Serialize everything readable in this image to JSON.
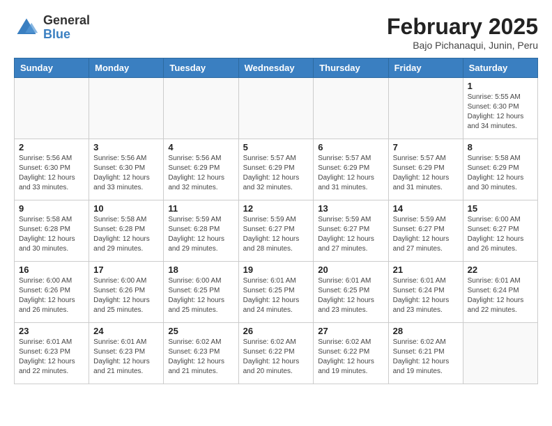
{
  "header": {
    "logo_general": "General",
    "logo_blue": "Blue",
    "title": "February 2025",
    "subtitle": "Bajo Pichanaqui, Junin, Peru"
  },
  "weekdays": [
    "Sunday",
    "Monday",
    "Tuesday",
    "Wednesday",
    "Thursday",
    "Friday",
    "Saturday"
  ],
  "weeks": [
    [
      {
        "day": "",
        "info": ""
      },
      {
        "day": "",
        "info": ""
      },
      {
        "day": "",
        "info": ""
      },
      {
        "day": "",
        "info": ""
      },
      {
        "day": "",
        "info": ""
      },
      {
        "day": "",
        "info": ""
      },
      {
        "day": "1",
        "info": "Sunrise: 5:55 AM\nSunset: 6:30 PM\nDaylight: 12 hours\nand 34 minutes."
      }
    ],
    [
      {
        "day": "2",
        "info": "Sunrise: 5:56 AM\nSunset: 6:30 PM\nDaylight: 12 hours\nand 33 minutes."
      },
      {
        "day": "3",
        "info": "Sunrise: 5:56 AM\nSunset: 6:30 PM\nDaylight: 12 hours\nand 33 minutes."
      },
      {
        "day": "4",
        "info": "Sunrise: 5:56 AM\nSunset: 6:29 PM\nDaylight: 12 hours\nand 32 minutes."
      },
      {
        "day": "5",
        "info": "Sunrise: 5:57 AM\nSunset: 6:29 PM\nDaylight: 12 hours\nand 32 minutes."
      },
      {
        "day": "6",
        "info": "Sunrise: 5:57 AM\nSunset: 6:29 PM\nDaylight: 12 hours\nand 31 minutes."
      },
      {
        "day": "7",
        "info": "Sunrise: 5:57 AM\nSunset: 6:29 PM\nDaylight: 12 hours\nand 31 minutes."
      },
      {
        "day": "8",
        "info": "Sunrise: 5:58 AM\nSunset: 6:29 PM\nDaylight: 12 hours\nand 30 minutes."
      }
    ],
    [
      {
        "day": "9",
        "info": "Sunrise: 5:58 AM\nSunset: 6:28 PM\nDaylight: 12 hours\nand 30 minutes."
      },
      {
        "day": "10",
        "info": "Sunrise: 5:58 AM\nSunset: 6:28 PM\nDaylight: 12 hours\nand 29 minutes."
      },
      {
        "day": "11",
        "info": "Sunrise: 5:59 AM\nSunset: 6:28 PM\nDaylight: 12 hours\nand 29 minutes."
      },
      {
        "day": "12",
        "info": "Sunrise: 5:59 AM\nSunset: 6:27 PM\nDaylight: 12 hours\nand 28 minutes."
      },
      {
        "day": "13",
        "info": "Sunrise: 5:59 AM\nSunset: 6:27 PM\nDaylight: 12 hours\nand 27 minutes."
      },
      {
        "day": "14",
        "info": "Sunrise: 5:59 AM\nSunset: 6:27 PM\nDaylight: 12 hours\nand 27 minutes."
      },
      {
        "day": "15",
        "info": "Sunrise: 6:00 AM\nSunset: 6:27 PM\nDaylight: 12 hours\nand 26 minutes."
      }
    ],
    [
      {
        "day": "16",
        "info": "Sunrise: 6:00 AM\nSunset: 6:26 PM\nDaylight: 12 hours\nand 26 minutes."
      },
      {
        "day": "17",
        "info": "Sunrise: 6:00 AM\nSunset: 6:26 PM\nDaylight: 12 hours\nand 25 minutes."
      },
      {
        "day": "18",
        "info": "Sunrise: 6:00 AM\nSunset: 6:25 PM\nDaylight: 12 hours\nand 25 minutes."
      },
      {
        "day": "19",
        "info": "Sunrise: 6:01 AM\nSunset: 6:25 PM\nDaylight: 12 hours\nand 24 minutes."
      },
      {
        "day": "20",
        "info": "Sunrise: 6:01 AM\nSunset: 6:25 PM\nDaylight: 12 hours\nand 23 minutes."
      },
      {
        "day": "21",
        "info": "Sunrise: 6:01 AM\nSunset: 6:24 PM\nDaylight: 12 hours\nand 23 minutes."
      },
      {
        "day": "22",
        "info": "Sunrise: 6:01 AM\nSunset: 6:24 PM\nDaylight: 12 hours\nand 22 minutes."
      }
    ],
    [
      {
        "day": "23",
        "info": "Sunrise: 6:01 AM\nSunset: 6:23 PM\nDaylight: 12 hours\nand 22 minutes."
      },
      {
        "day": "24",
        "info": "Sunrise: 6:01 AM\nSunset: 6:23 PM\nDaylight: 12 hours\nand 21 minutes."
      },
      {
        "day": "25",
        "info": "Sunrise: 6:02 AM\nSunset: 6:23 PM\nDaylight: 12 hours\nand 21 minutes."
      },
      {
        "day": "26",
        "info": "Sunrise: 6:02 AM\nSunset: 6:22 PM\nDaylight: 12 hours\nand 20 minutes."
      },
      {
        "day": "27",
        "info": "Sunrise: 6:02 AM\nSunset: 6:22 PM\nDaylight: 12 hours\nand 19 minutes."
      },
      {
        "day": "28",
        "info": "Sunrise: 6:02 AM\nSunset: 6:21 PM\nDaylight: 12 hours\nand 19 minutes."
      },
      {
        "day": "",
        "info": ""
      }
    ]
  ]
}
